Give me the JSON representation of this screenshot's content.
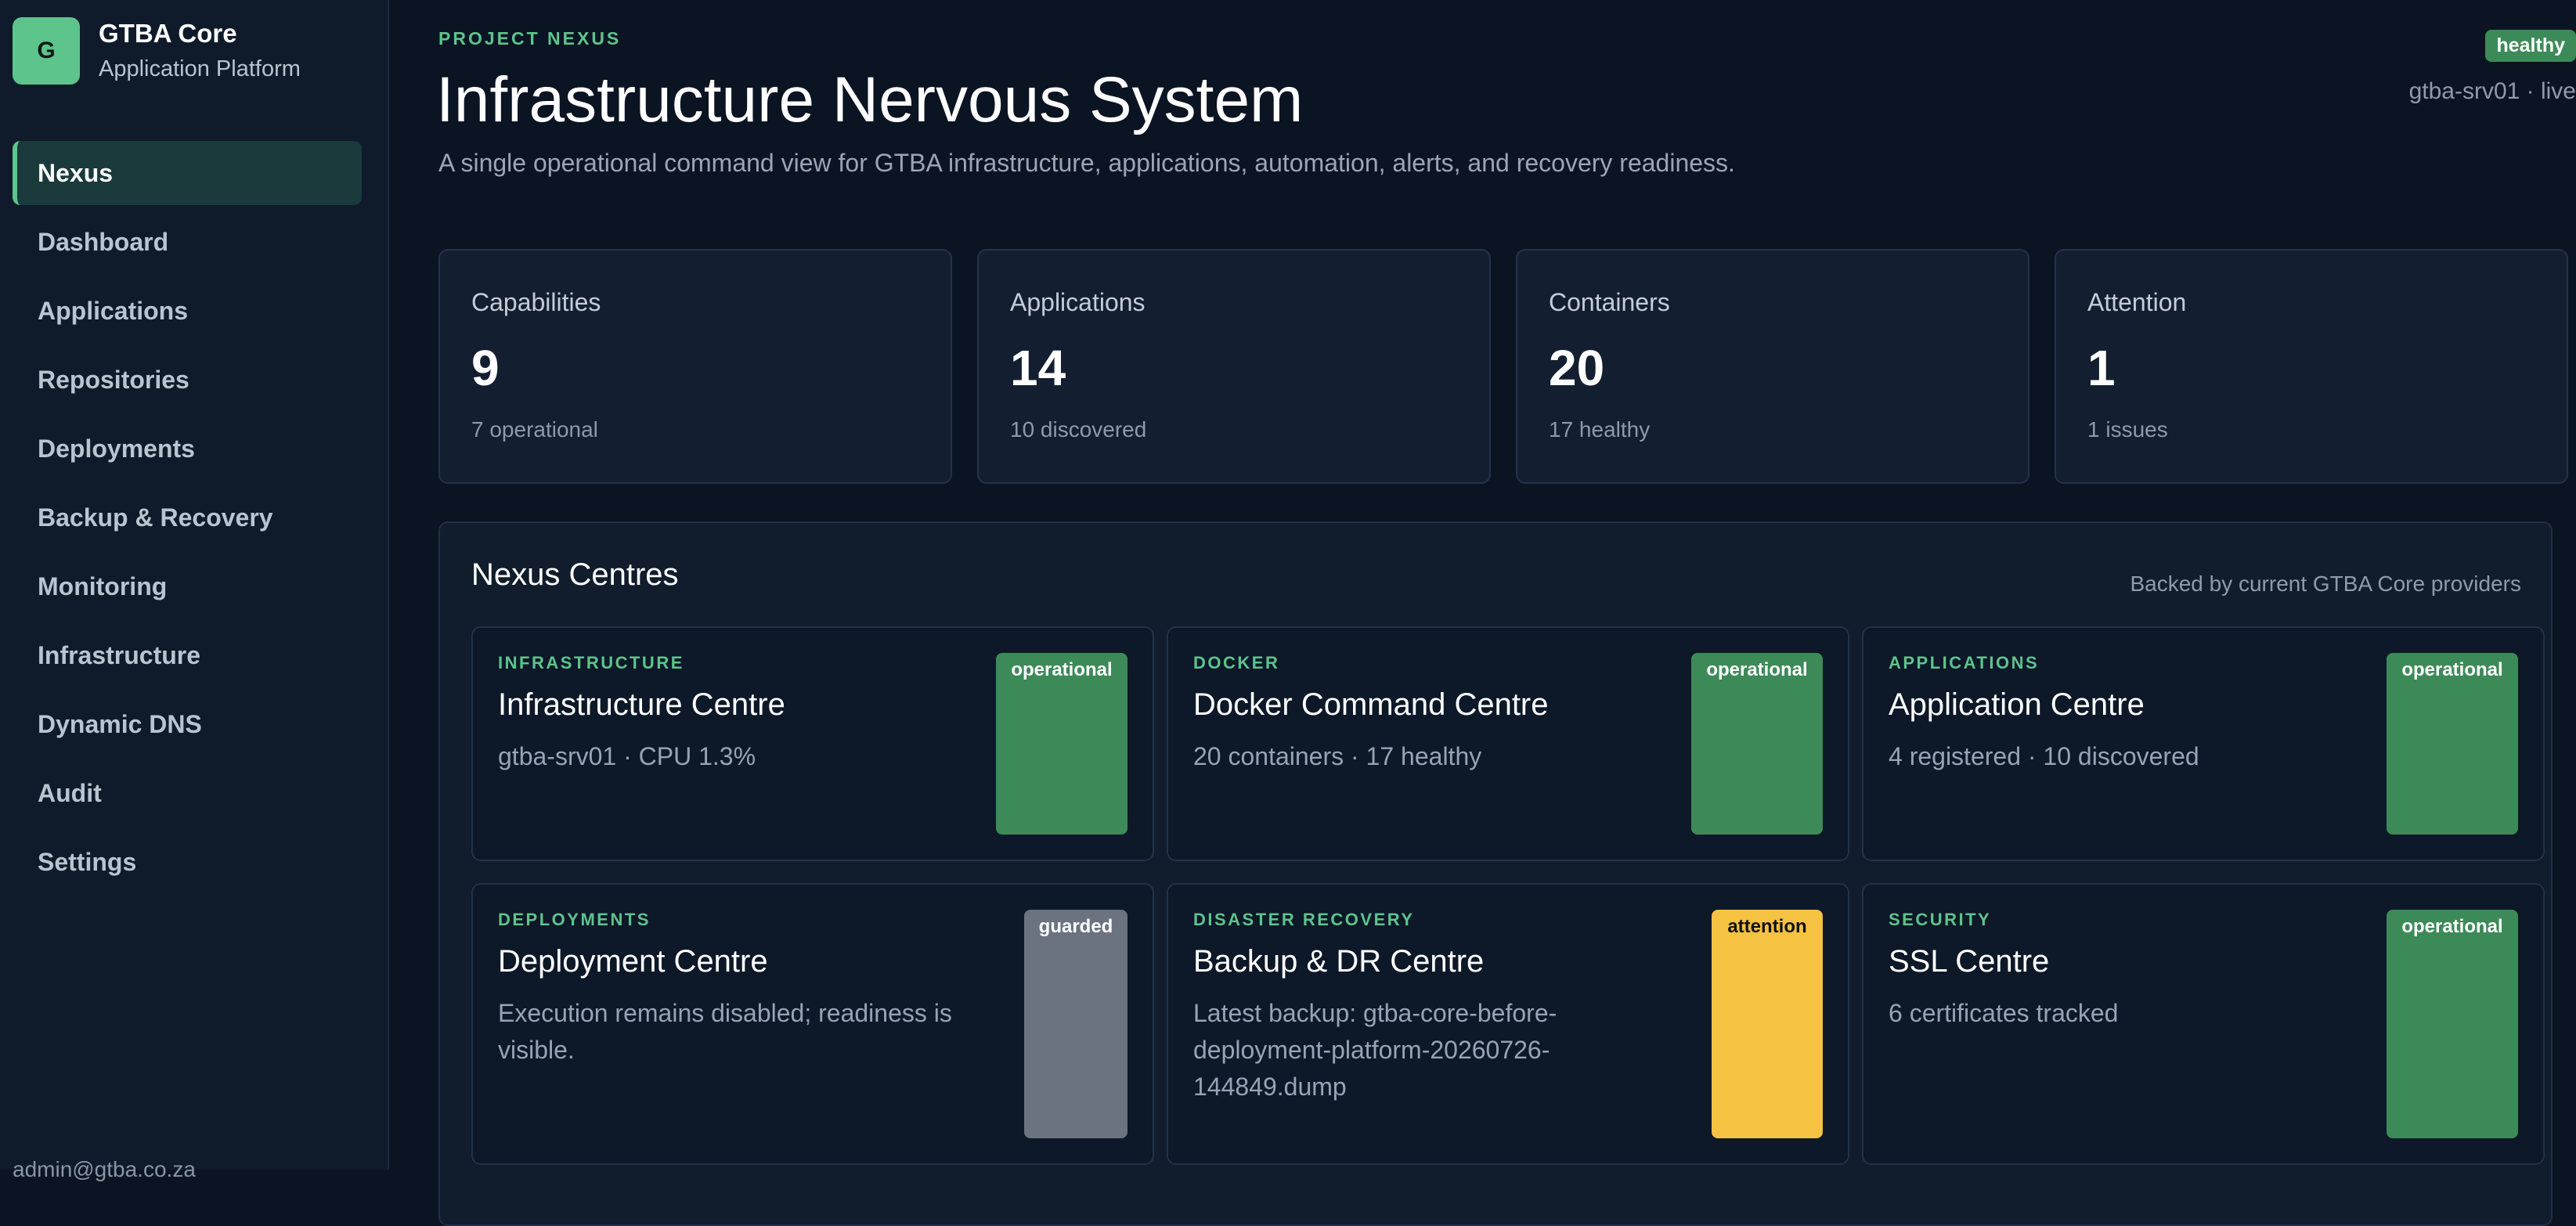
{
  "brand": {
    "logo_letter": "G",
    "title": "GTBA Core",
    "subtitle": "Application Platform"
  },
  "nav": {
    "items": [
      {
        "label": "Nexus",
        "active": true
      },
      {
        "label": "Dashboard"
      },
      {
        "label": "Applications"
      },
      {
        "label": "Repositories"
      },
      {
        "label": "Deployments"
      },
      {
        "label": "Backup & Recovery"
      },
      {
        "label": "Monitoring"
      },
      {
        "label": "Infrastructure"
      },
      {
        "label": "Dynamic DNS"
      },
      {
        "label": "Audit"
      },
      {
        "label": "Settings"
      }
    ]
  },
  "user": {
    "email": "admin@gtba.co.za"
  },
  "header": {
    "eyebrow": "PROJECT NEXUS",
    "title": "Infrastructure Nervous System",
    "description": "A single operational command view for GTBA infrastructure, applications, automation, alerts, and recovery readiness.",
    "health": "healthy",
    "host_status": "gtba-srv01 · live"
  },
  "stats": [
    {
      "label": "Capabilities",
      "value": "9",
      "sub": "7 operational"
    },
    {
      "label": "Applications",
      "value": "14",
      "sub": "10 discovered"
    },
    {
      "label": "Containers",
      "value": "20",
      "sub": "17 healthy"
    },
    {
      "label": "Attention",
      "value": "1",
      "sub": "1 issues"
    }
  ],
  "centres": {
    "title": "Nexus Centres",
    "note": "Backed by current GTBA Core providers",
    "cards": [
      {
        "category": "INFRASTRUCTURE",
        "title": "Infrastructure Centre",
        "desc": "gtba-srv01 · CPU 1.3%",
        "status": "operational"
      },
      {
        "category": "DOCKER",
        "title": "Docker Command Centre",
        "desc": "20 containers · 17 healthy",
        "status": "operational"
      },
      {
        "category": "APPLICATIONS",
        "title": "Application Centre",
        "desc": "4 registered · 10 discovered",
        "status": "operational"
      },
      {
        "category": "DEPLOYMENTS",
        "title": "Deployment Centre",
        "desc": "Execution remains disabled; readiness is visible.",
        "status": "guarded"
      },
      {
        "category": "DISASTER RECOVERY",
        "title": "Backup & DR Centre",
        "desc": "Latest backup: gtba-core-before-deployment-platform-20260726-144849.dump",
        "status": "attention"
      },
      {
        "category": "SECURITY",
        "title": "SSL Centre",
        "desc": "6 certificates tracked",
        "status": "operational"
      }
    ]
  },
  "colors": {
    "accent": "#5dc48c",
    "operational": "#3d8a59",
    "guarded": "#6b7380",
    "attention": "#f5c242",
    "background": "#0b1422"
  }
}
